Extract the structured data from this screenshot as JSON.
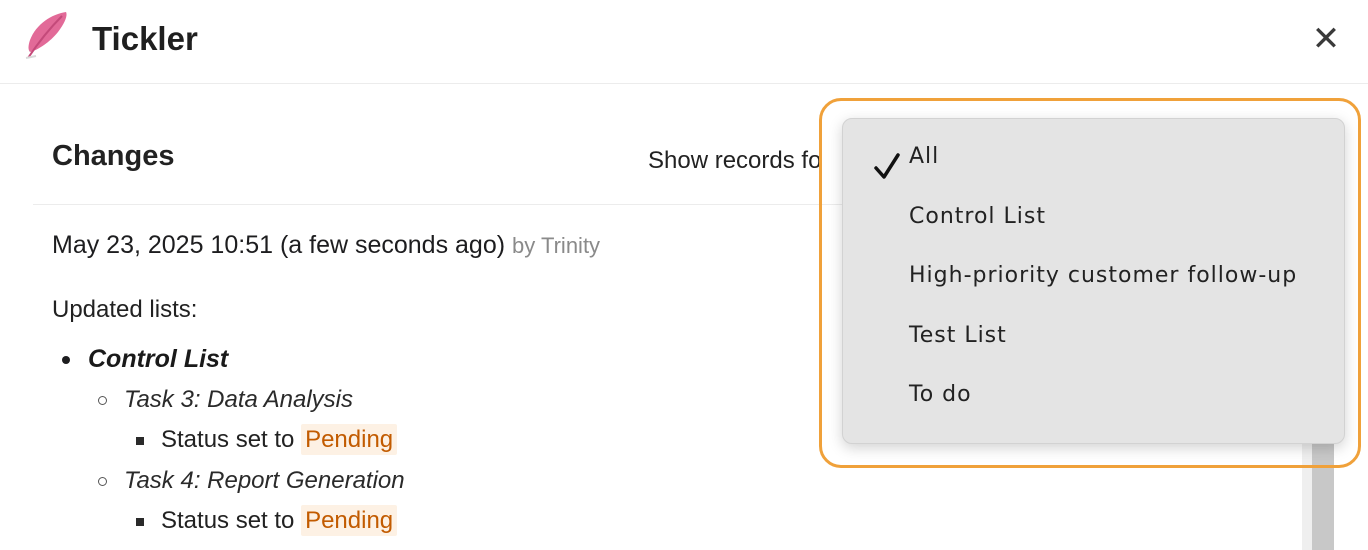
{
  "header": {
    "app_title": "Tickler",
    "close_label": "✕",
    "logo_icon": "feather-icon",
    "logo_color": "#e05a8f"
  },
  "section": {
    "title": "Changes",
    "filter_label": "Show records fo"
  },
  "entry": {
    "timestamp": "May 23, 2025 10:51 (a few seconds ago)",
    "by_label": "by Trinity",
    "updated_label": "Updated lists:",
    "list_name": "Control List",
    "tasks": [
      {
        "name": "Task 3: Data Analysis",
        "status_prefix": "Status set to",
        "status_value": "Pending"
      },
      {
        "name": "Task 4: Report Generation",
        "status_prefix": "Status set to",
        "status_value": "Pending"
      }
    ],
    "status_color": "#c25b00"
  },
  "dropdown": {
    "selected": "All",
    "highlight_color": "#f0a13a",
    "options": [
      {
        "label": "All"
      },
      {
        "label": "Control List"
      },
      {
        "label": "High-priority customer follow-up"
      },
      {
        "label": "Test List"
      },
      {
        "label": "To do"
      }
    ]
  }
}
